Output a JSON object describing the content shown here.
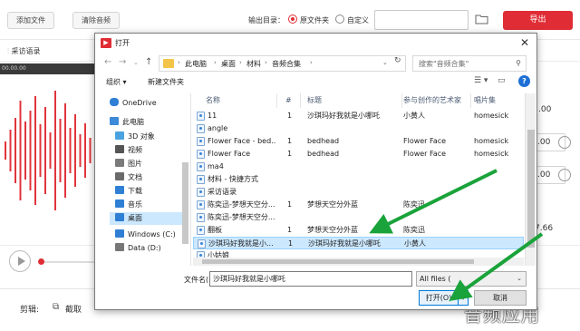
{
  "app": {
    "add_file": "添加文件",
    "clear_audio": "清除音频",
    "output_dir_label": "输出目录：",
    "radio_original": "原文件夹",
    "radio_custom": "自定义",
    "export": "导出",
    "track_name": "采访语录",
    "time_start": "00.00.00",
    "right_values": [
      ".00",
      ".00",
      ".00",
      "7.66"
    ],
    "edit_label": "剪辑:",
    "cut_label": "截取",
    "watermark": "音频应用",
    "accent_color": "#e02d35"
  },
  "dialog": {
    "title": "打开",
    "breadcrumb": [
      "此电脑",
      "桌面",
      "材料",
      "音频合集"
    ],
    "search_placeholder": "搜索\"音频合集\"",
    "toolbar": {
      "organize": "组织 ▾",
      "new_folder": "新建文件夹"
    },
    "nav_items": [
      {
        "label": "OneDrive",
        "color": "#2f7fd5"
      },
      {
        "label": "此电脑",
        "color": "#3c8ad8"
      },
      {
        "label": "3D 对象",
        "color": "#4aa3e0"
      },
      {
        "label": "视频",
        "color": "#555555"
      },
      {
        "label": "图片",
        "color": "#7a7a7a"
      },
      {
        "label": "文档",
        "color": "#6a6a6a"
      },
      {
        "label": "下载",
        "color": "#2f7fd5"
      },
      {
        "label": "音乐",
        "color": "#2f7fd5"
      },
      {
        "label": "桌面",
        "color": "#2f7fd5"
      },
      {
        "label": "Windows (C:)",
        "color": "#2f7fd5"
      },
      {
        "label": "Data (D:)",
        "color": "#777777"
      }
    ],
    "columns": [
      "名称",
      "#",
      "标题",
      "参与创作的艺术家",
      "唱片集"
    ],
    "rows": [
      {
        "name": "11",
        "num": "1",
        "title": "沙琪玛好我就是小哪吒",
        "artist": "小黄人",
        "album": "homesick"
      },
      {
        "name": "angle",
        "num": "",
        "title": "",
        "artist": "",
        "album": ""
      },
      {
        "name": "Flower Face - bed...",
        "num": "1",
        "title": "bedhead",
        "artist": "Flower Face",
        "album": "homesick"
      },
      {
        "name": "Flower Face",
        "num": "1",
        "title": "bedhead",
        "artist": "Flower Face",
        "album": "homesick"
      },
      {
        "name": "ma4",
        "num": "",
        "title": "",
        "artist": "",
        "album": ""
      },
      {
        "name": "材料 - 快捷方式",
        "num": "",
        "title": "",
        "artist": "",
        "album": ""
      },
      {
        "name": "采访语录",
        "num": "",
        "title": "",
        "artist": "",
        "album": ""
      },
      {
        "name": "陈奕迅-梦想天空分...",
        "num": "1",
        "title": "梦想天空分外蓝",
        "artist": "陈奕迅",
        "album": ""
      },
      {
        "name": "陈奕迅-梦想天空分...",
        "num": "",
        "title": "",
        "artist": "",
        "album": ""
      },
      {
        "name": "翻板",
        "num": "1",
        "title": "梦想天空分外蓝",
        "artist": "陈奕迅",
        "album": ""
      },
      {
        "name": "沙琪玛好我就是小...",
        "num": "1",
        "title": "沙琪玛好我就是小哪吒",
        "artist": "小黄人",
        "album": ""
      },
      {
        "name": "小姑娘",
        "num": "",
        "title": "",
        "artist": "",
        "album": ""
      }
    ],
    "selected_row": 10,
    "filename_label": "文件名(N):",
    "filename_value": "沙琪玛好我就是小哪吒",
    "filetype_value": "All files (",
    "open_button": "打开(O)",
    "cancel_button": "取消"
  }
}
